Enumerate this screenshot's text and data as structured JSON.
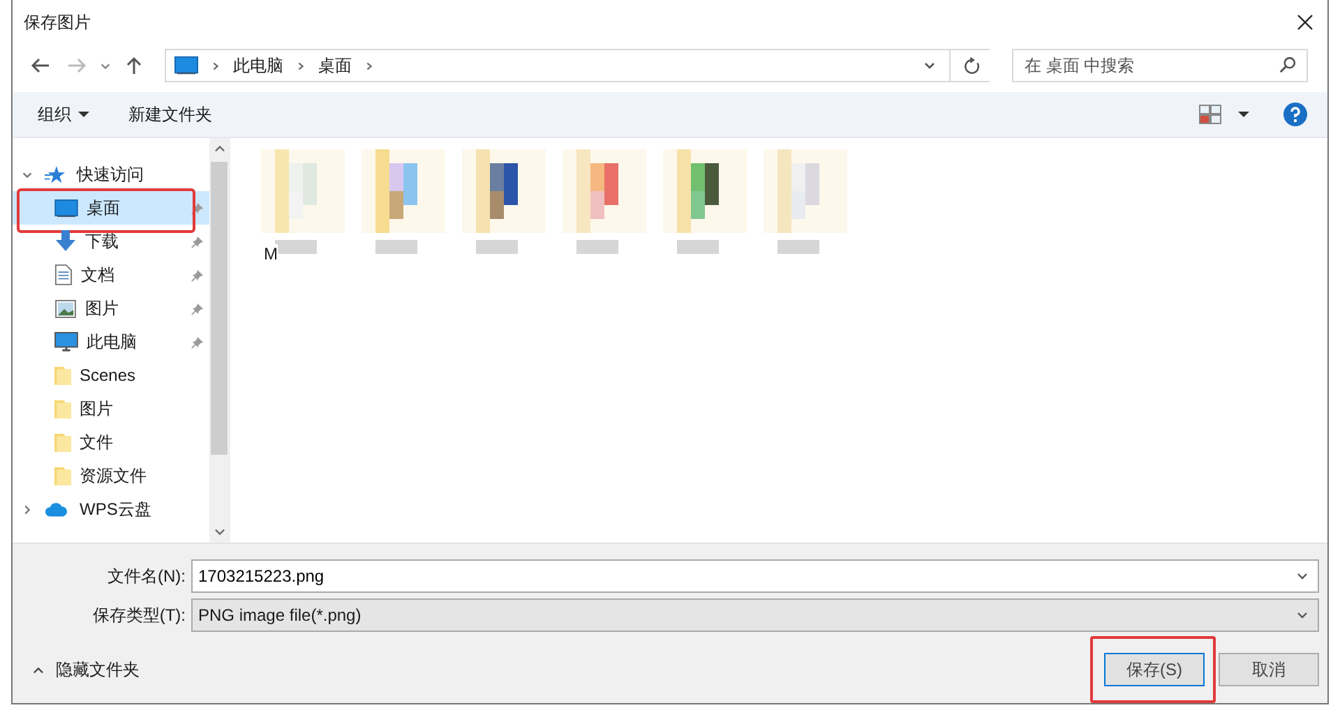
{
  "window": {
    "title": "保存图片"
  },
  "address": {
    "crumbs": [
      "此电脑",
      "桌面"
    ]
  },
  "search": {
    "placeholder": "在 桌面 中搜索"
  },
  "toolbar": {
    "organize": "组织",
    "new_folder": "新建文件夹"
  },
  "sidebar": {
    "items": [
      {
        "label": "快速访问",
        "kind": "star",
        "expanded": true,
        "selected": false,
        "children": [
          {
            "label": "桌面",
            "kind": "desktop",
            "pinned": true,
            "selected": true
          },
          {
            "label": "下载",
            "kind": "download",
            "pinned": true,
            "selected": false
          },
          {
            "label": "文档",
            "kind": "document",
            "pinned": true,
            "selected": false
          },
          {
            "label": "图片",
            "kind": "pictures",
            "pinned": true,
            "selected": false
          },
          {
            "label": "此电脑",
            "kind": "computer",
            "pinned": true,
            "selected": false
          },
          {
            "label": "Scenes",
            "kind": "folder",
            "pinned": false,
            "selected": false
          },
          {
            "label": "图片",
            "kind": "folder",
            "pinned": false,
            "selected": false
          },
          {
            "label": "文件",
            "kind": "folder",
            "pinned": false,
            "selected": false
          },
          {
            "label": "资源文件",
            "kind": "folder",
            "pinned": false,
            "selected": false
          }
        ]
      },
      {
        "label": "WPS云盘",
        "kind": "cloud",
        "expanded": false,
        "selected": false
      }
    ]
  },
  "files": [
    {
      "kind": "picture",
      "label": "M"
    },
    {
      "kind": "picture"
    },
    {
      "kind": "picture"
    },
    {
      "kind": "picture"
    },
    {
      "kind": "picture"
    },
    {
      "kind": "picture"
    }
  ],
  "form": {
    "filename_label": "文件名(N):",
    "filename": "1703215223.png",
    "type_label": "保存类型(T):",
    "type": "PNG image file(*.png)"
  },
  "footer": {
    "hide_folders": "隐藏文件夹",
    "buttons": [
      "保存(S)",
      "取消"
    ]
  }
}
